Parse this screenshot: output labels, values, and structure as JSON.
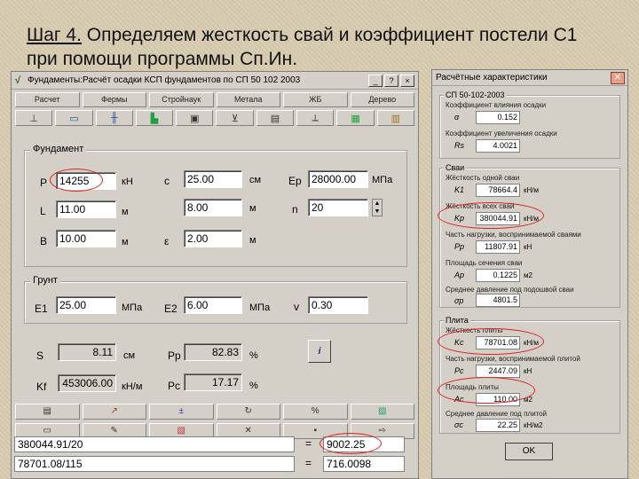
{
  "slide": {
    "title_step": "Шаг 4.",
    "title_rest": " Определяем жесткость свай и коэффициент постели С1 при помощи программы Сп.Ин."
  },
  "window": {
    "title": "Фундаменты:Расчёт осадки КСП фундаментов по СП 50 102 2003",
    "tabs": [
      "Расчет",
      "Фермы",
      "Стройнаук",
      "Метала",
      "ЖБ",
      "Дерево"
    ],
    "foundation": {
      "group_label": "Фундамент",
      "P_label": "P",
      "P_value": "14255",
      "P_unit": "кН",
      "c_label": "c",
      "c_value": "25.00",
      "c_unit": "см",
      "Ep_label": "Ep",
      "Ep_value": "28000.00",
      "Ep_unit": "МПа",
      "L_label": "L",
      "L_value": "11.00",
      "L_unit": "м",
      "f2_value": "8.00",
      "f2_unit": "м",
      "n_label": "n",
      "n_value": "20",
      "B_label": "B",
      "B_value": "10.00",
      "B_unit": "м",
      "eps_label": "ε",
      "eps_value": "2.00",
      "eps_unit": "м"
    },
    "soil": {
      "group_label": "Грунт",
      "E1_label": "E1",
      "E1_value": "25.00",
      "E1_unit": "МПа",
      "E2_label": "E2",
      "E2_value": "6.00",
      "E2_unit": "МПа",
      "v_label": "v",
      "v_value": "0.30"
    },
    "results": {
      "S_label": "S",
      "S_value": "8.11",
      "S_unit": "см",
      "Pp_label": "Pp",
      "Pp_value": "82.83",
      "Pp_unit": "%",
      "Kf_label": "Kf",
      "Kf_value": "453006.00",
      "Kf_unit": "кН/м",
      "Pc_label": "Pc",
      "Pc_value": "17.17",
      "Pc_unit": "%",
      "info_button": "i"
    },
    "calc": {
      "row1_expr": "380044.91/20",
      "row1_eq": "=",
      "row1_result": "9002.25",
      "row2_expr": "78701.08/115",
      "row2_eq": "=",
      "row2_result": "716.0098"
    }
  },
  "dialog": {
    "title": "Расчётные характеристики",
    "close": "✕",
    "sp_group": "СП 50-102-2003",
    "coef_label": "Коэффициент влияния осадки",
    "coef_sym": "α",
    "coef_value": "0.152",
    "coef2_label": "Коэффициент увеличения осадки",
    "coef2_sym": "Rs",
    "coef2_value": "4.0021",
    "pile_group": "Сваи",
    "k1_label": "Жёсткость одной сваи",
    "k1_sym": "K1",
    "k1_value": "78664.4",
    "k1_unit": "кН/м",
    "kp_label": "Жёсткость всех свай",
    "kp_sym": "Kp",
    "kp_value": "380044.91",
    "kp_unit": "кН/м",
    "pp_label": "Часть нагрузки, воспринимаемой сваями",
    "pp_sym": "Pp",
    "pp_value": "11807.91",
    "pp_unit": "кН",
    "ap_label": "Площадь сечения сваи",
    "ap_sym": "Ap",
    "ap_value": "0.1225",
    "ap_unit": "м2",
    "sp_label": "Среднее давление под подошвой сваи",
    "sp_sym": "σp",
    "sp_value": "4801.5",
    "sp_unit": "",
    "slab_group": "Плита",
    "kc_label": "Жёсткость плиты",
    "kc_sym": "Kc",
    "kc_value": "78701.08",
    "kc_unit": "кН/м",
    "pc_label": "Часть нагрузки, воспринимаемой плитой",
    "pc_sym": "Pc",
    "pc_value": "2447.09",
    "pc_unit": "кН",
    "ac_label": "Площадь плиты",
    "ac_sym": "Ac",
    "ac_value": "110.00",
    "ac_unit": "м2",
    "sc_label": "Среднее давление под плитой",
    "sc_sym": "σc",
    "sc_value": "22.25",
    "sc_unit": "кН/м2",
    "ok": "OK"
  }
}
